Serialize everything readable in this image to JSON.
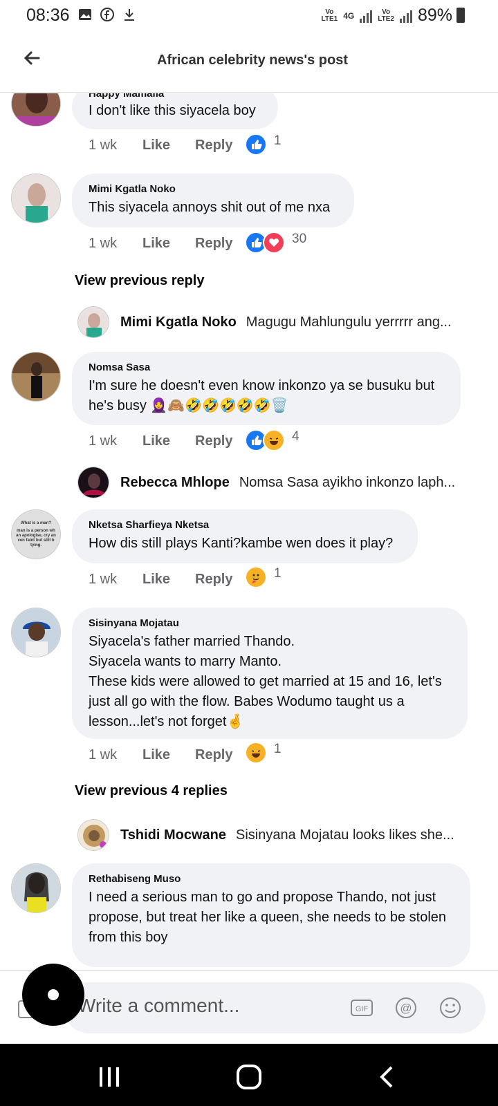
{
  "status_bar": {
    "time": "08:36",
    "sim1": "Vo\nLTE1",
    "network": "4G",
    "sim2": "Vo\nLTE2",
    "battery": "89%"
  },
  "header": {
    "title": "African celebrity news's post"
  },
  "comments": [
    {
      "name": "Happy Mamalla",
      "text": "I don't like this siyacela boy",
      "time": "1 wk",
      "like": "Like",
      "reply": "Reply",
      "reactions": [
        "like"
      ],
      "count": "1"
    },
    {
      "name": "Mimi Kgatla Noko",
      "text": "This siyacela annoys shit out of me nxa",
      "time": "1 wk",
      "like": "Like",
      "reply": "Reply",
      "reactions": [
        "like",
        "love"
      ],
      "count": "30"
    },
    {
      "name": "Nomsa Sasa",
      "text": "I'm sure he doesn't even know inkonzo ya se busuku but he's busy 🧕🙈🤣🤣🤣🤣🤣🗑️",
      "time": "1 wk",
      "like": "Like",
      "reply": "Reply",
      "reactions": [
        "like",
        "laugh"
      ],
      "count": "4"
    },
    {
      "name": "Nketsa Sharfieya Nketsa",
      "text": "How dis still plays Kanti?kambe wen does it play?",
      "time": "1 wk",
      "like": "Like",
      "reply": "Reply",
      "reactions": [
        "care"
      ],
      "count": "1"
    },
    {
      "name": "Sisinyana Mojatau",
      "text": "Siyacela's father married Thando.\nSiyacela wants to marry Manto.\nThese kids were allowed to get married at 15 and 16, let's just all go with the flow. Babes Wodumo taught us a lesson...let's not forget🤞",
      "time": "1 wk",
      "like": "Like",
      "reply": "Reply",
      "reactions": [
        "laugh"
      ],
      "count": "1"
    },
    {
      "name": "Rethabiseng Muso",
      "text": "I need a serious man to go and propose Thando, not just propose, but treat her like a queen, she needs to be stolen from this boy"
    }
  ],
  "view_previous": [
    "View previous reply",
    "View previous 4 replies"
  ],
  "replies": [
    {
      "name": "Mimi Kgatla Noko",
      "text": "Magugu Mahlungulu yerrrrr ang..."
    },
    {
      "name": "Rebecca Mhlope",
      "text": "Nomsa Sasa ayikho inkonzo laph..."
    },
    {
      "name": "Tshidi Mocwane",
      "text": "Sisinyana Mojatau looks likes she..."
    }
  ],
  "avatar_caption": {
    "line1": "What is a man?",
    "line2": "man is a person wh\nan apologise, cry an\nven faint but still b\ntying."
  },
  "composer": {
    "placeholder": "Write a comment...",
    "gif_label": "GIF",
    "at_label": "@"
  },
  "colors": {
    "bubble": "#f0f2f5",
    "like_blue": "#1877f2",
    "love_red": "#f33e58",
    "haha_yellow": "#f7b125"
  }
}
